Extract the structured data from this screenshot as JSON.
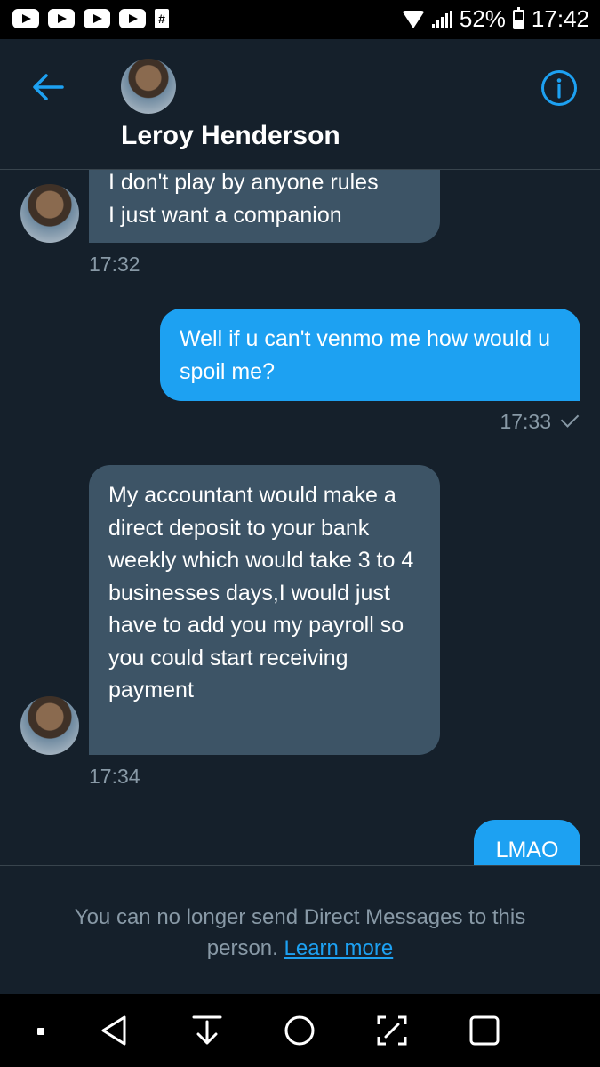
{
  "status_bar": {
    "battery": "52%",
    "time": "17:42"
  },
  "header": {
    "contact_name": "Leroy Henderson"
  },
  "messages": [
    {
      "direction": "incoming",
      "text": "I don't play by anyone rules\nI just want a companion",
      "time": "17:32"
    },
    {
      "direction": "outgoing",
      "text": "Well if u can't venmo me how would u spoil me?",
      "time": "17:33"
    },
    {
      "direction": "incoming",
      "text": "My accountant would make a direct deposit to your bank weekly which would take 3 to 4 businesses days,I would just have to add you my payroll so you could start receiving payment",
      "time": "17:34"
    },
    {
      "direction": "outgoing",
      "text": "LMAO"
    }
  ],
  "footer": {
    "notice": "You can no longer send Direct Messages to this person.",
    "link": "Learn more"
  },
  "colors": {
    "background": "#15202b",
    "incoming_bubble": "#3d5466",
    "outgoing_bubble": "#1da1f2",
    "muted_text": "#8899a6"
  },
  "icons": {
    "back": "arrow-left-icon",
    "info": "info-icon",
    "read_receipt": "checkmark-icon"
  }
}
